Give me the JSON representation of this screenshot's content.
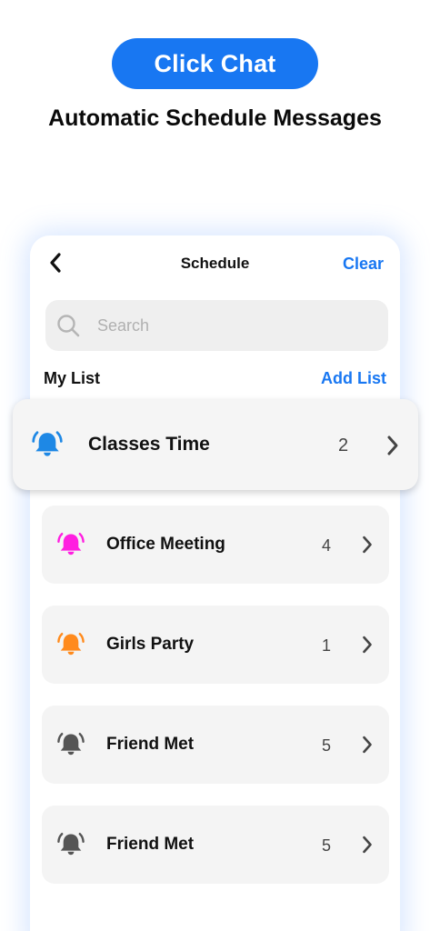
{
  "promo": {
    "button_label": "Click Chat",
    "headline": "Automatic Schedule Messages"
  },
  "nav": {
    "back_icon": "chevron-left-icon",
    "title": "Schedule",
    "clear_label": "Clear"
  },
  "search": {
    "icon": "search-icon",
    "value": "",
    "placeholder": "Search"
  },
  "list_header": {
    "title": "My List",
    "add_label": "Add List"
  },
  "lists": [
    {
      "name": "Classes Time",
      "count": "2",
      "bell_color": "#1e88e5",
      "icon": "bell-icon"
    },
    {
      "name": "Office Meeting",
      "count": "4",
      "bell_color": "#ff1ee0",
      "icon": "bell-icon"
    },
    {
      "name": "Girls Party",
      "count": "1",
      "bell_color": "#ff8a1c",
      "icon": "bell-icon"
    },
    {
      "name": "Friend Met",
      "count": "5",
      "bell_color": "#555555",
      "icon": "bell-icon"
    },
    {
      "name": "Friend Met",
      "count": "5",
      "bell_color": "#555555",
      "icon": "bell-icon"
    }
  ],
  "colors": {
    "accent": "#1877f2",
    "row_background": "#f4f4f4"
  }
}
